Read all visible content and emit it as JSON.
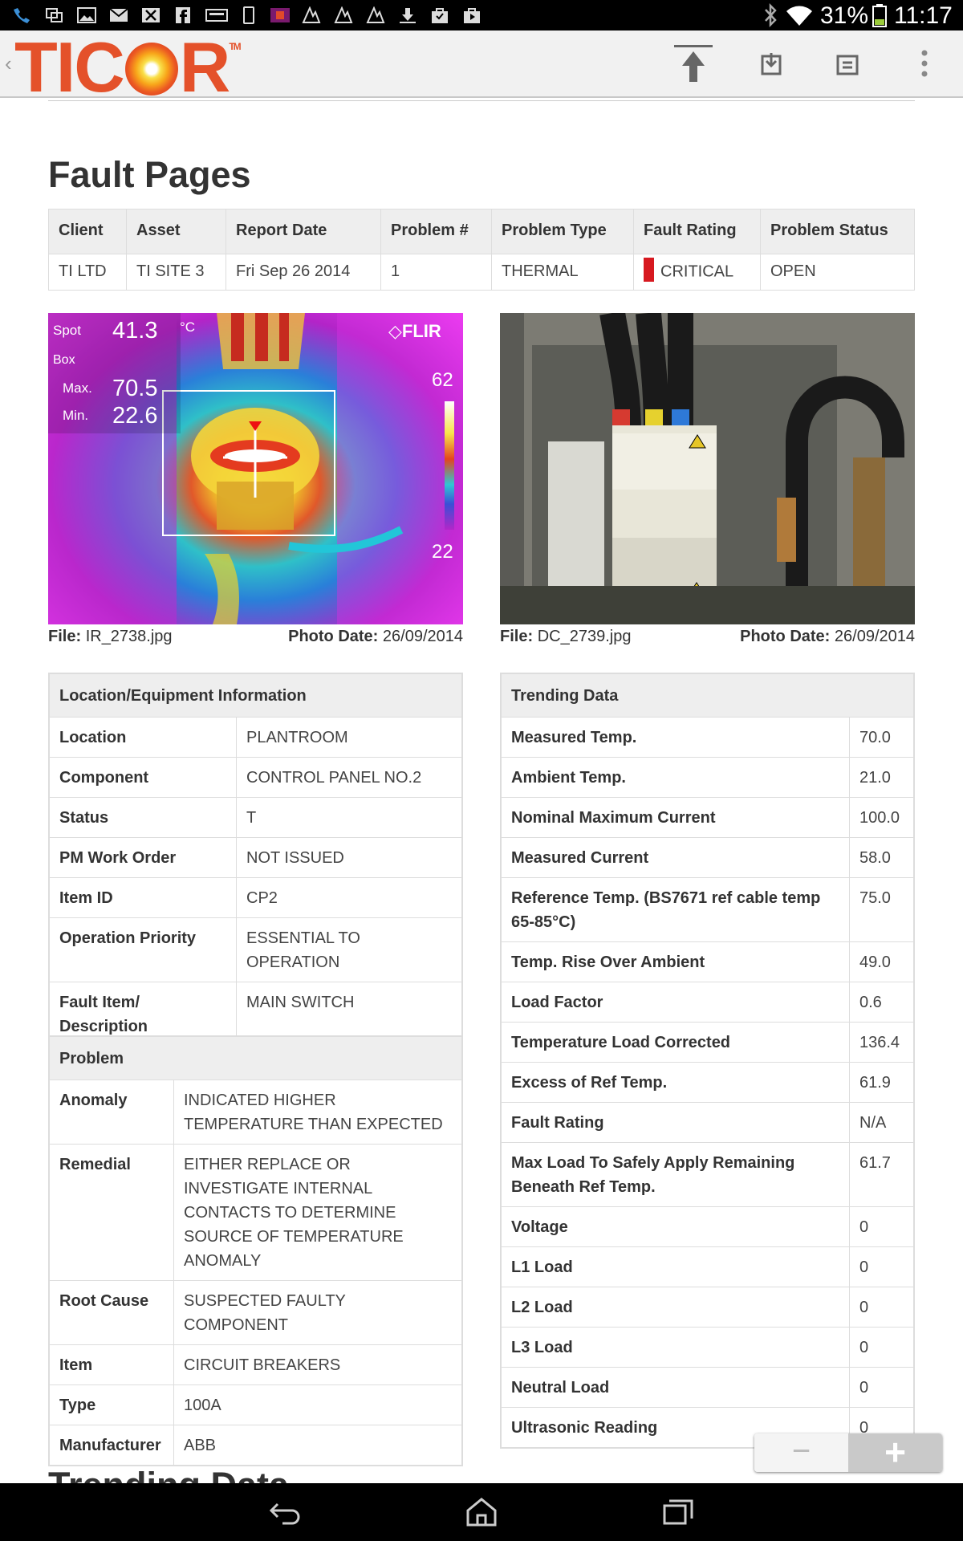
{
  "statusbar": {
    "battery_text": "31%",
    "time": "11:17",
    "notif_icons": [
      "phone-missed-icon",
      "screenshot-icon",
      "image-icon",
      "mail-icon",
      "x-box-icon",
      "facebook-icon",
      "keyboard-icon",
      "tablet-icon",
      "thermal-image-icon",
      "sync-icon",
      "sync-icon",
      "sync-icon",
      "download-icon",
      "store-icon",
      "store-icon"
    ]
  },
  "appbar": {
    "logo_text_left": "TIC",
    "logo_text_right": "R",
    "logo_tm": "TM",
    "actions": [
      "scroll-to-top-icon",
      "import-icon",
      "export-icon",
      "overflow-menu-icon"
    ]
  },
  "page": {
    "title": "Fault Pages",
    "trending_heading": "Trending Data"
  },
  "fault_table": {
    "headers": [
      "Client",
      "Asset",
      "Report Date",
      "Problem #",
      "Problem Type",
      "Fault Rating",
      "Problem Status"
    ],
    "row": [
      "TI LTD",
      "TI SITE 3",
      "Fri Sep 26 2014",
      "1",
      "THERMAL",
      "CRITICAL",
      "OPEN"
    ],
    "rating_color": "#d71920"
  },
  "ir_photo": {
    "spot_label": "Spot",
    "spot_value": "41.3",
    "unit": "°C",
    "box_label": "Box",
    "max_label": "Max.",
    "max_value": "70.5",
    "min_label": "Min.",
    "min_value": "22.6",
    "brand": "FLIR",
    "scale_top": "62",
    "scale_bottom": "22",
    "file_label": "File:",
    "file": "IR_2738.jpg",
    "date_label": "Photo Date:",
    "date": "26/09/2014"
  },
  "dc_photo": {
    "file_label": "File:",
    "file": "DC_2739.jpg",
    "date_label": "Photo Date:",
    "date": "26/09/2014"
  },
  "location_info": {
    "heading": "Location/Equipment Information",
    "rows": [
      {
        "k": "Location",
        "v": "PLANTROOM"
      },
      {
        "k": "Component",
        "v": "CONTROL PANEL NO.2"
      },
      {
        "k": "Status",
        "v": "T"
      },
      {
        "k": "PM Work Order",
        "v": "NOT ISSUED"
      },
      {
        "k": "Item ID",
        "v": "CP2"
      },
      {
        "k": "Operation Priority",
        "v": "ESSENTIAL TO OPERATION"
      },
      {
        "k": "Fault Item/ Description",
        "v": "MAIN SWITCH"
      }
    ]
  },
  "problem": {
    "heading": "Problem",
    "rows": [
      {
        "k": "Anomaly",
        "v": "INDICATED HIGHER TEMPERATURE THAN EXPECTED"
      },
      {
        "k": "Remedial",
        "v": "EITHER REPLACE OR INVESTIGATE INTERNAL CONTACTS TO DETERMINE SOURCE OF TEMPERATURE ANOMALY"
      },
      {
        "k": "Root Cause",
        "v": "SUSPECTED FAULTY COMPONENT"
      },
      {
        "k": "Item",
        "v": "CIRCUIT BREAKERS"
      },
      {
        "k": "Type",
        "v": "100A"
      },
      {
        "k": "Manufacturer",
        "v": "ABB"
      }
    ]
  },
  "trending": {
    "heading": "Trending Data",
    "rows": [
      {
        "k": "Measured Temp.",
        "v": "70.0"
      },
      {
        "k": "Ambient Temp.",
        "v": "21.0"
      },
      {
        "k": "Nominal Maximum Current",
        "v": "100.0"
      },
      {
        "k": "Measured Current",
        "v": "58.0"
      },
      {
        "k": "Reference Temp. (BS7671 ref cable temp 65-85°C)",
        "v": "75.0"
      },
      {
        "k": "Temp. Rise Over Ambient",
        "v": "49.0"
      },
      {
        "k": "Load Factor",
        "v": "0.6"
      },
      {
        "k": "Temperature Load Corrected",
        "v": "136.4"
      },
      {
        "k": "Excess of Ref Temp.",
        "v": "61.9"
      },
      {
        "k": "Fault Rating",
        "v": "N/A"
      },
      {
        "k": "Max Load To Safely Apply Remaining Beneath Ref Temp.",
        "v": "61.7"
      },
      {
        "k": "Voltage",
        "v": "0"
      },
      {
        "k": "L1 Load",
        "v": "0"
      },
      {
        "k": "L2 Load",
        "v": "0"
      },
      {
        "k": "L3 Load",
        "v": "0"
      },
      {
        "k": "Neutral Load",
        "v": "0"
      },
      {
        "k": "Ultrasonic Reading",
        "v": "0"
      }
    ]
  },
  "zoom": {
    "out": "−",
    "in": "+"
  },
  "navbar": [
    "back-icon",
    "home-icon",
    "recent-apps-icon"
  ]
}
